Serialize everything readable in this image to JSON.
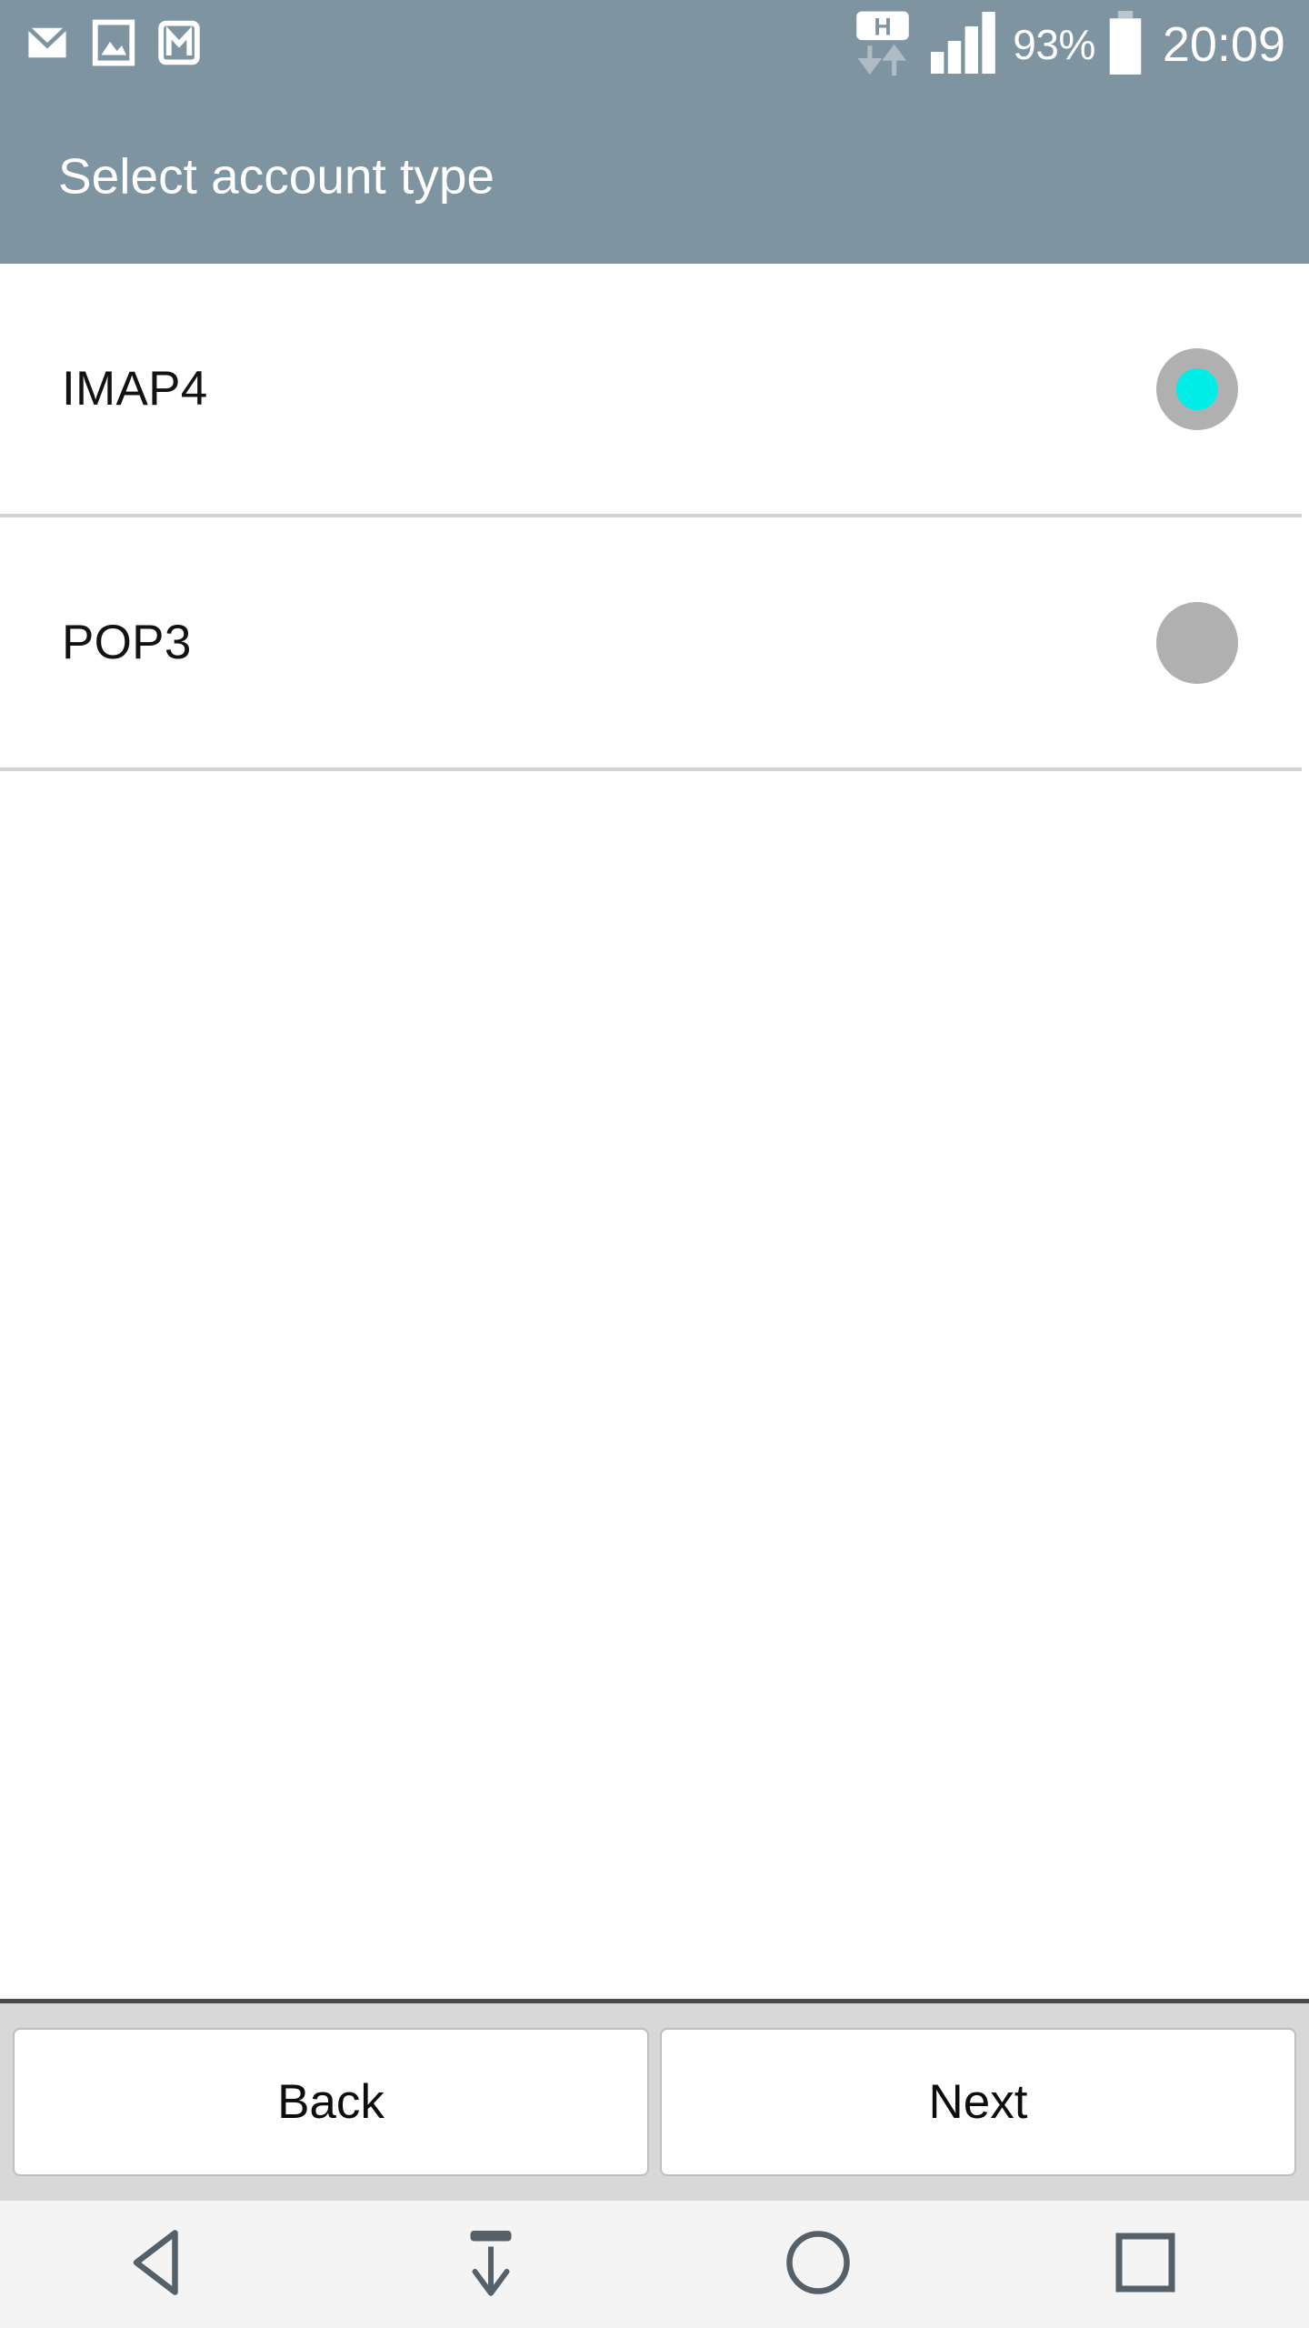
{
  "status_bar": {
    "left_icons": [
      {
        "name": "email-envelope-icon",
        "label": "Email"
      },
      {
        "name": "gallery-image-icon",
        "label": "Gallery"
      },
      {
        "name": "gmail-icon",
        "label": "Gmail"
      }
    ],
    "network_type": "H",
    "data_arrows": "down-up",
    "signal_bars": 4,
    "battery_percent": "93%",
    "time": "20:09",
    "background_color": "#7e94a1",
    "foreground_color": "#ffffff"
  },
  "header": {
    "title": "Select account type",
    "background_color": "#7e94a1",
    "text_color": "#ffffff"
  },
  "account_types": {
    "options": [
      {
        "label": "IMAP4",
        "selected": true
      },
      {
        "label": "POP3",
        "selected": false
      }
    ],
    "selected_color": "#00eee8",
    "radio_color": "#b0b0b0",
    "divider_color": "#d3d3d3"
  },
  "bottom_bar": {
    "back_label": "Back",
    "next_label": "Next",
    "background_color": "#d8d8d8",
    "button_background": "#ffffff"
  },
  "nav_bar": {
    "buttons": [
      {
        "name": "nav-back-icon",
        "label": "Back"
      },
      {
        "name": "nav-hide-keyboard-icon",
        "label": "Hide keyboard"
      },
      {
        "name": "nav-home-icon",
        "label": "Home"
      },
      {
        "name": "nav-recents-icon",
        "label": "Recent apps"
      }
    ],
    "background_color": "#f4f4f4",
    "icon_color": "#566069"
  }
}
